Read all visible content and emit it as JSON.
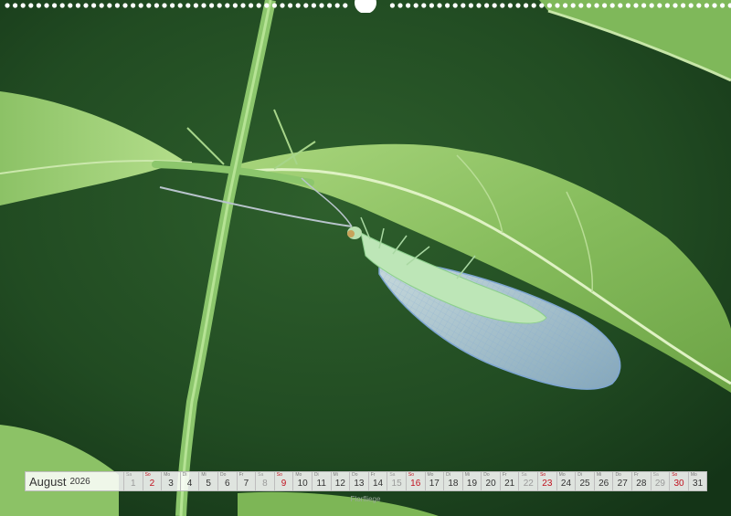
{
  "calendar": {
    "month": "August",
    "year": "2026",
    "days": [
      {
        "wd": "Sa",
        "n": "1",
        "k": "sat"
      },
      {
        "wd": "So",
        "n": "2",
        "k": "sun"
      },
      {
        "wd": "Mo",
        "n": "3",
        "k": ""
      },
      {
        "wd": "Di",
        "n": "4",
        "k": ""
      },
      {
        "wd": "Mi",
        "n": "5",
        "k": ""
      },
      {
        "wd": "Do",
        "n": "6",
        "k": ""
      },
      {
        "wd": "Fr",
        "n": "7",
        "k": ""
      },
      {
        "wd": "Sa",
        "n": "8",
        "k": "sat"
      },
      {
        "wd": "So",
        "n": "9",
        "k": "sun"
      },
      {
        "wd": "Mo",
        "n": "10",
        "k": ""
      },
      {
        "wd": "Di",
        "n": "11",
        "k": ""
      },
      {
        "wd": "Mi",
        "n": "12",
        "k": ""
      },
      {
        "wd": "Do",
        "n": "13",
        "k": ""
      },
      {
        "wd": "Fr",
        "n": "14",
        "k": ""
      },
      {
        "wd": "Sa",
        "n": "15",
        "k": "sat"
      },
      {
        "wd": "So",
        "n": "16",
        "k": "sun"
      },
      {
        "wd": "Mo",
        "n": "17",
        "k": ""
      },
      {
        "wd": "Di",
        "n": "18",
        "k": ""
      },
      {
        "wd": "Mi",
        "n": "19",
        "k": ""
      },
      {
        "wd": "Do",
        "n": "20",
        "k": ""
      },
      {
        "wd": "Fr",
        "n": "21",
        "k": ""
      },
      {
        "wd": "Sa",
        "n": "22",
        "k": "sat"
      },
      {
        "wd": "So",
        "n": "23",
        "k": "sun"
      },
      {
        "wd": "Mo",
        "n": "24",
        "k": ""
      },
      {
        "wd": "Di",
        "n": "25",
        "k": ""
      },
      {
        "wd": "Mi",
        "n": "26",
        "k": ""
      },
      {
        "wd": "Do",
        "n": "27",
        "k": ""
      },
      {
        "wd": "Fr",
        "n": "28",
        "k": ""
      },
      {
        "wd": "Sa",
        "n": "29",
        "k": "sat"
      },
      {
        "wd": "So",
        "n": "30",
        "k": "sun"
      },
      {
        "wd": "Mo",
        "n": "31",
        "k": ""
      }
    ]
  },
  "caption": "Florfliege",
  "colors": {
    "background": "#1f4a22",
    "leaf": "#8fc468",
    "stem": "#8cc66c",
    "wing": "#c9dcef",
    "sunday": "#c1121f"
  }
}
